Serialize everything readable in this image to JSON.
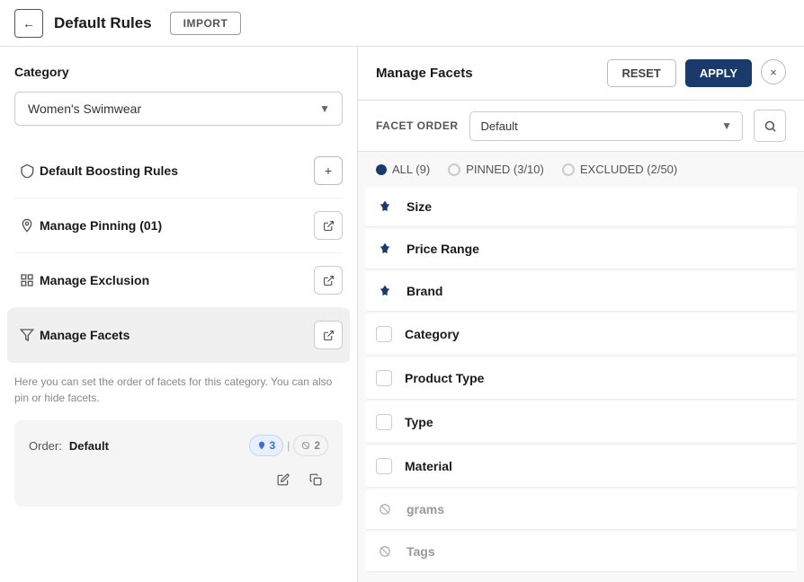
{
  "header": {
    "back_label": "←",
    "title": "Default Rules",
    "import_label": "IMPORT"
  },
  "left_panel": {
    "category_section_title": "Category",
    "category_options": [
      "Women's Swimwear"
    ],
    "category_selected": "Women's Swimwear",
    "menu_items": [
      {
        "id": "boosting",
        "label": "Default Boosting Rules",
        "icon": "shield",
        "action": "add"
      },
      {
        "id": "pinning",
        "label": "Manage Pinning (01)",
        "icon": "pin",
        "action": "external"
      },
      {
        "id": "exclusion",
        "label": "Manage Exclusion",
        "icon": "grid",
        "action": "external"
      },
      {
        "id": "facets",
        "label": "Manage Facets",
        "icon": "filter",
        "action": "external"
      }
    ],
    "info_text": "Here you can set the order of facets for this category. You can also pin or hide facets.",
    "order_section": {
      "label": "Order:",
      "value": "Default",
      "pin_count": "3",
      "separator": "|",
      "exclude_count": "2"
    }
  },
  "right_panel": {
    "title": "Manage Facets",
    "reset_label": "RESET",
    "apply_label": "APPLY",
    "close_label": "×",
    "facet_order_label": "FACET ORDER",
    "facet_order_options": [
      "Default"
    ],
    "facet_order_selected": "Default",
    "filter_tabs": [
      {
        "id": "all",
        "label": "ALL (9)",
        "active": true
      },
      {
        "id": "pinned",
        "label": "PINNED (3/10)",
        "active": false
      },
      {
        "id": "excluded",
        "label": "EXCLUDED (2/50)",
        "active": false
      }
    ],
    "facets": [
      {
        "id": "size",
        "name": "Size",
        "state": "pinned"
      },
      {
        "id": "price-range",
        "name": "Price Range",
        "state": "pinned"
      },
      {
        "id": "brand",
        "name": "Brand",
        "state": "pinned"
      },
      {
        "id": "category",
        "name": "Category",
        "state": "unchecked"
      },
      {
        "id": "product-type",
        "name": "Product Type",
        "state": "unchecked"
      },
      {
        "id": "type",
        "name": "Type",
        "state": "unchecked"
      },
      {
        "id": "material",
        "name": "Material",
        "state": "unchecked"
      },
      {
        "id": "grams",
        "name": "grams",
        "state": "excluded"
      },
      {
        "id": "tags",
        "name": "Tags",
        "state": "excluded"
      }
    ]
  }
}
